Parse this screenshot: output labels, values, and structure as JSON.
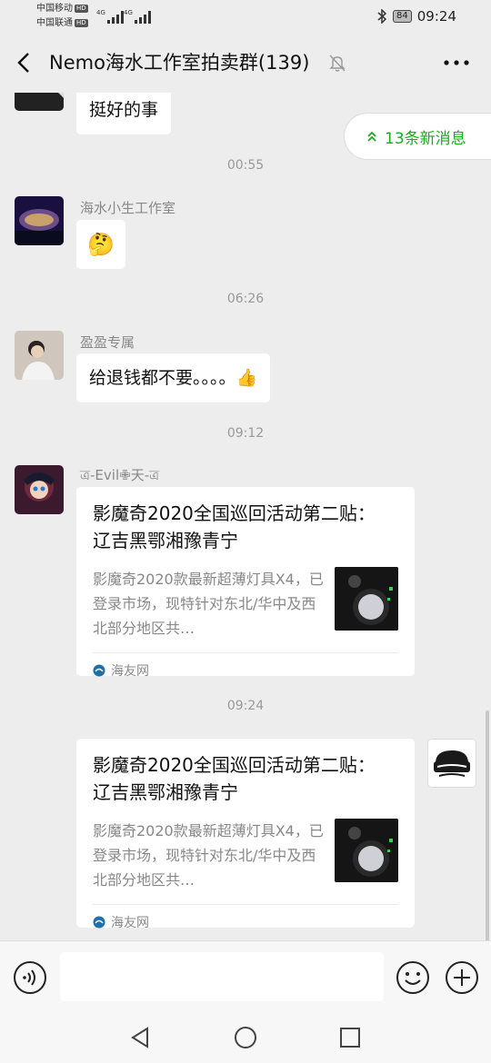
{
  "status": {
    "carrier1": "中国移动",
    "carrier2": "中国联通",
    "hd": "HD",
    "battery": "84",
    "time": "09:24"
  },
  "header": {
    "title": "Nemo海水工作室拍卖群(139)"
  },
  "new_messages": "13条新消息",
  "messages": [
    {
      "text": "挺好的事"
    },
    {
      "time": "00:55"
    },
    {
      "sender": "海水小生工作室",
      "emoji": "🤔"
    },
    {
      "time": "06:26"
    },
    {
      "sender": "盈盈专属",
      "text": "给退钱都不要。。。。👍"
    },
    {
      "time": "09:12"
    },
    {
      "sender": "ত্র-Evil✙天-ত্র",
      "card_title": "影魔奇2020全国巡回活动第二贴： 辽吉黑鄂湘豫青宁",
      "card_desc": "影魔奇2020款最新超薄灯具X4，已登录市场，现特针对东北/华中及西北部分地区共…",
      "source": "海友网"
    },
    {
      "time": "09:24"
    },
    {
      "card_title": "影魔奇2020全国巡回活动第二贴： 辽吉黑鄂湘豫青宁",
      "card_desc": "影魔奇2020款最新超薄灯具X4，已登录市场，现特针对东北/华中及西北部分地区共…",
      "source": "海友网"
    }
  ],
  "colors": {
    "accent": "#1aad19",
    "background": "#ededed"
  },
  "icons": [
    "back-icon",
    "mute-icon",
    "more-icon",
    "voice-icon",
    "emoji-icon",
    "plus-icon",
    "nav-back-icon",
    "nav-home-icon",
    "nav-recent-icon"
  ]
}
